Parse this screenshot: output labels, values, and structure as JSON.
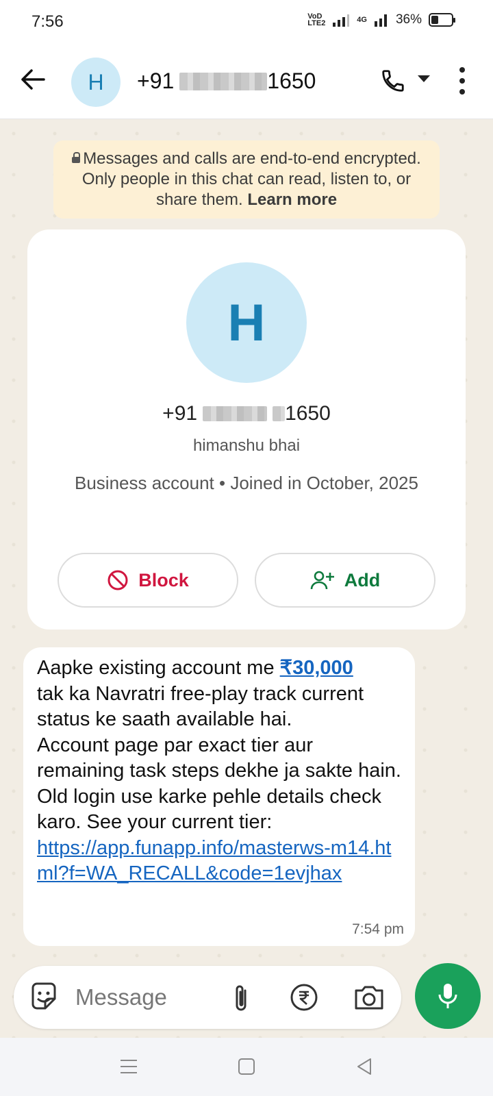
{
  "status_bar": {
    "time": "7:56",
    "volte_label": "VoD LTE2",
    "network_label": "4G",
    "battery_percent": "36%",
    "battery_level": 0.36
  },
  "header": {
    "avatar_letter": "H",
    "phone_prefix": "+91",
    "phone_suffix": "1650"
  },
  "encryption_notice": {
    "text": "Messages and calls are end-to-end encrypted. Only people in this chat can read, listen to, or share them.",
    "link": "Learn more"
  },
  "contact_card": {
    "avatar_letter": "H",
    "phone_prefix": "+91",
    "phone_suffix": "1650",
    "name": "himanshu bhai",
    "info": "Business account • Joined in October, 2025",
    "block_label": "Block",
    "add_label": "Add"
  },
  "message": {
    "text_before_amount": "Aapke existing account me ",
    "amount": "₹30,000",
    "text_after_amount": "\ntak ka Navratri free-play track current status ke saath available hai.\nAccount page par exact tier aur remaining task steps dekhe ja sakte hain.\nOld login use karke pehle details check karo. See your current tier:\n",
    "link": "https://app.funapp.info/masterws-m14.html?f=WA_RECALL&code=1evjhax",
    "time": "7:54 pm"
  },
  "composer": {
    "placeholder": "Message"
  },
  "icons": {
    "back": "arrow-left-icon",
    "call": "phone-icon",
    "menu": "more-vertical-icon",
    "block": "block-icon",
    "add": "add-person-icon",
    "sticker": "sticker-icon",
    "attach": "paperclip-icon",
    "payment": "rupee-icon",
    "camera": "camera-icon",
    "mic": "mic-icon"
  },
  "colors": {
    "accent_green": "#1aa15b",
    "block_red": "#d0163f",
    "link_blue": "#1565c0",
    "avatar_bg": "#cdeaf7",
    "notice_bg": "#fdf0d5"
  }
}
